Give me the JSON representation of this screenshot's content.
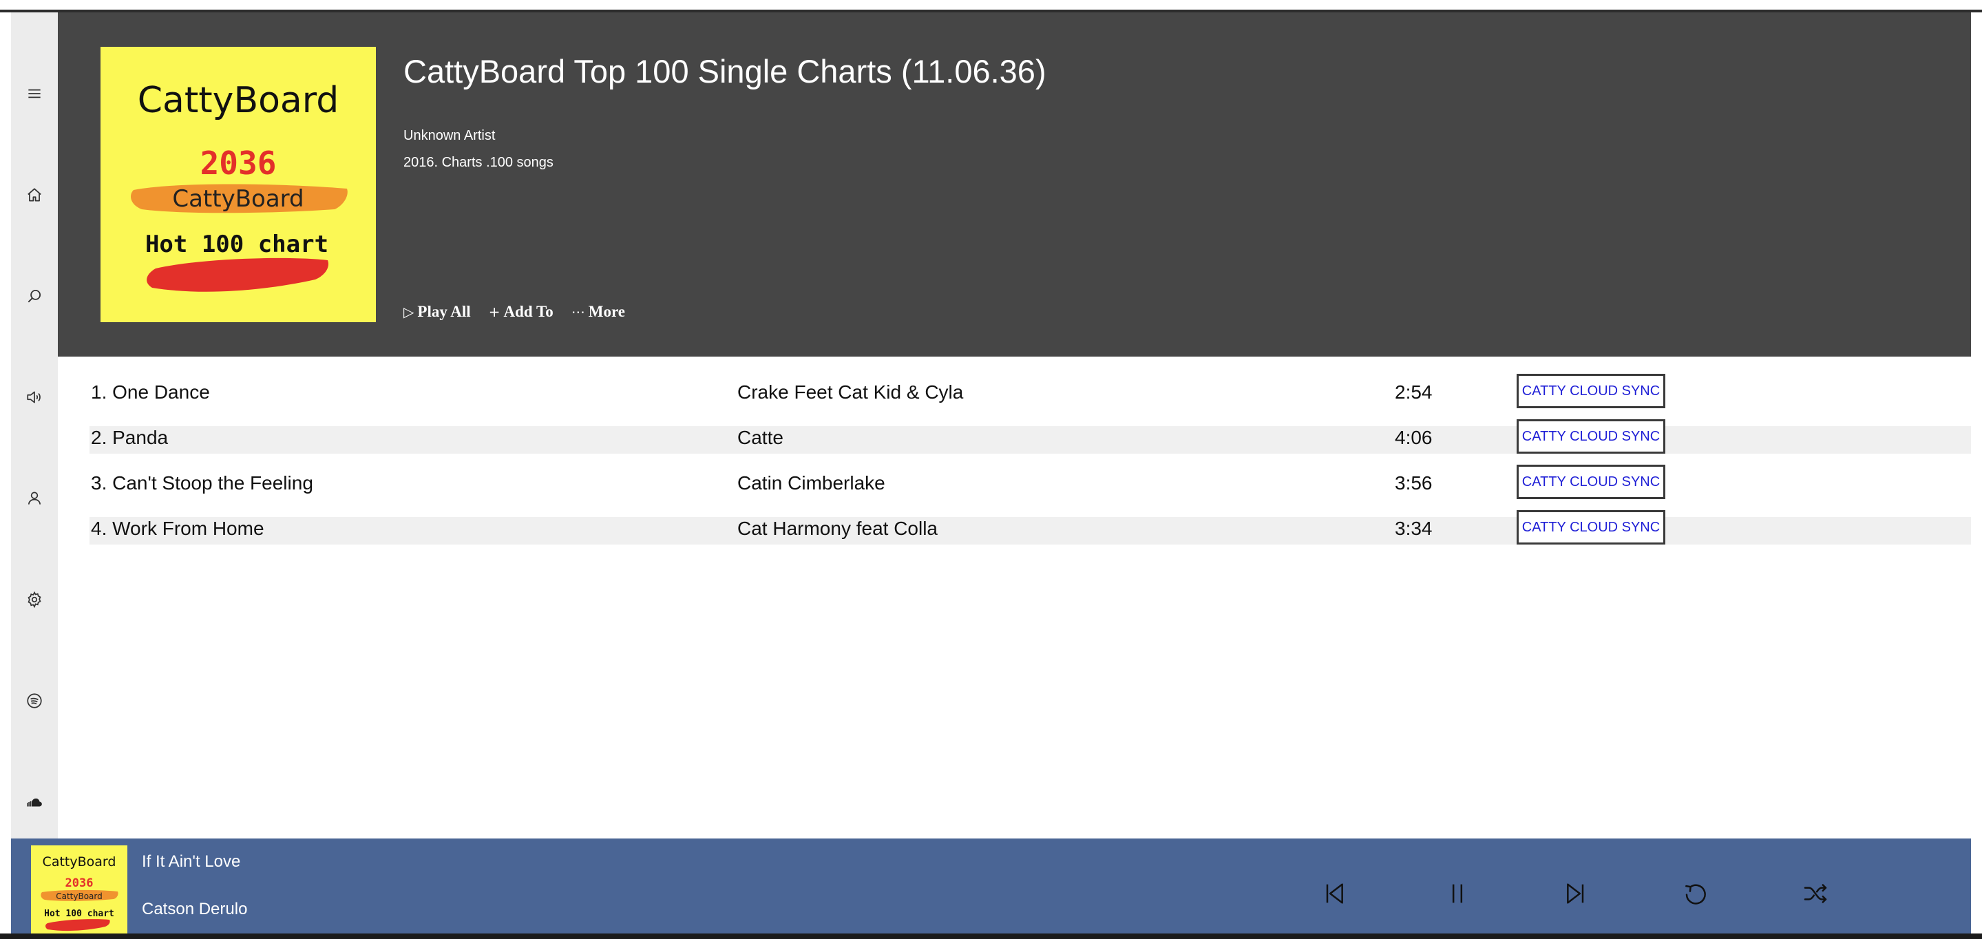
{
  "album": {
    "title": "CattyBoard Top 100 Single Charts (11.06.36)",
    "artist": "Unknown Artist",
    "meta": "2016. Charts .100 songs",
    "cover": {
      "brand": "CattyBoard",
      "year": "2036",
      "sub_brand": "CattyBoard",
      "chart_name": "Hot 100 chart"
    }
  },
  "actions": {
    "play_all": "Play All",
    "add_to": "Add To",
    "more": "More"
  },
  "sidebar": {
    "items": [
      "menu-icon",
      "home-icon",
      "search-icon",
      "volume-icon",
      "user-icon",
      "gear-icon",
      "spotify-icon",
      "cloud-icon"
    ]
  },
  "tracks": [
    {
      "name": "1. One Dance",
      "artist": "Crake Feet Cat Kid & Cyla",
      "duration": "2:54",
      "action": "CATTY CLOUD SYNC"
    },
    {
      "name": "2. Panda",
      "artist": "Catte",
      "duration": "4:06",
      "action": "CATTY CLOUD SYNC"
    },
    {
      "name": "3. Can't Stoop the Feeling",
      "artist": "Catin Cimberlake",
      "duration": "3:56",
      "action": "CATTY CLOUD SYNC"
    },
    {
      "name": "4. Work From Home",
      "artist": "Cat Harmony feat Colla",
      "duration": "3:34",
      "action": "CATTY CLOUD SYNC"
    }
  ],
  "now_playing": {
    "title": "If It Ain't Love",
    "artist": "Catson Derulo",
    "cover": {
      "brand": "CattyBoard",
      "year": "2036",
      "sub_brand": "CattyBoard",
      "chart_name": "Hot 100 chart"
    }
  },
  "colors": {
    "header_bg": "#464646",
    "sidebar_bg": "#ececec",
    "player_bg": "#4a6595",
    "cover_bg": "#fbf855",
    "cover_red": "#e3302a",
    "cover_orange": "#ef8a2c",
    "sync_text": "#1f1fd6"
  }
}
